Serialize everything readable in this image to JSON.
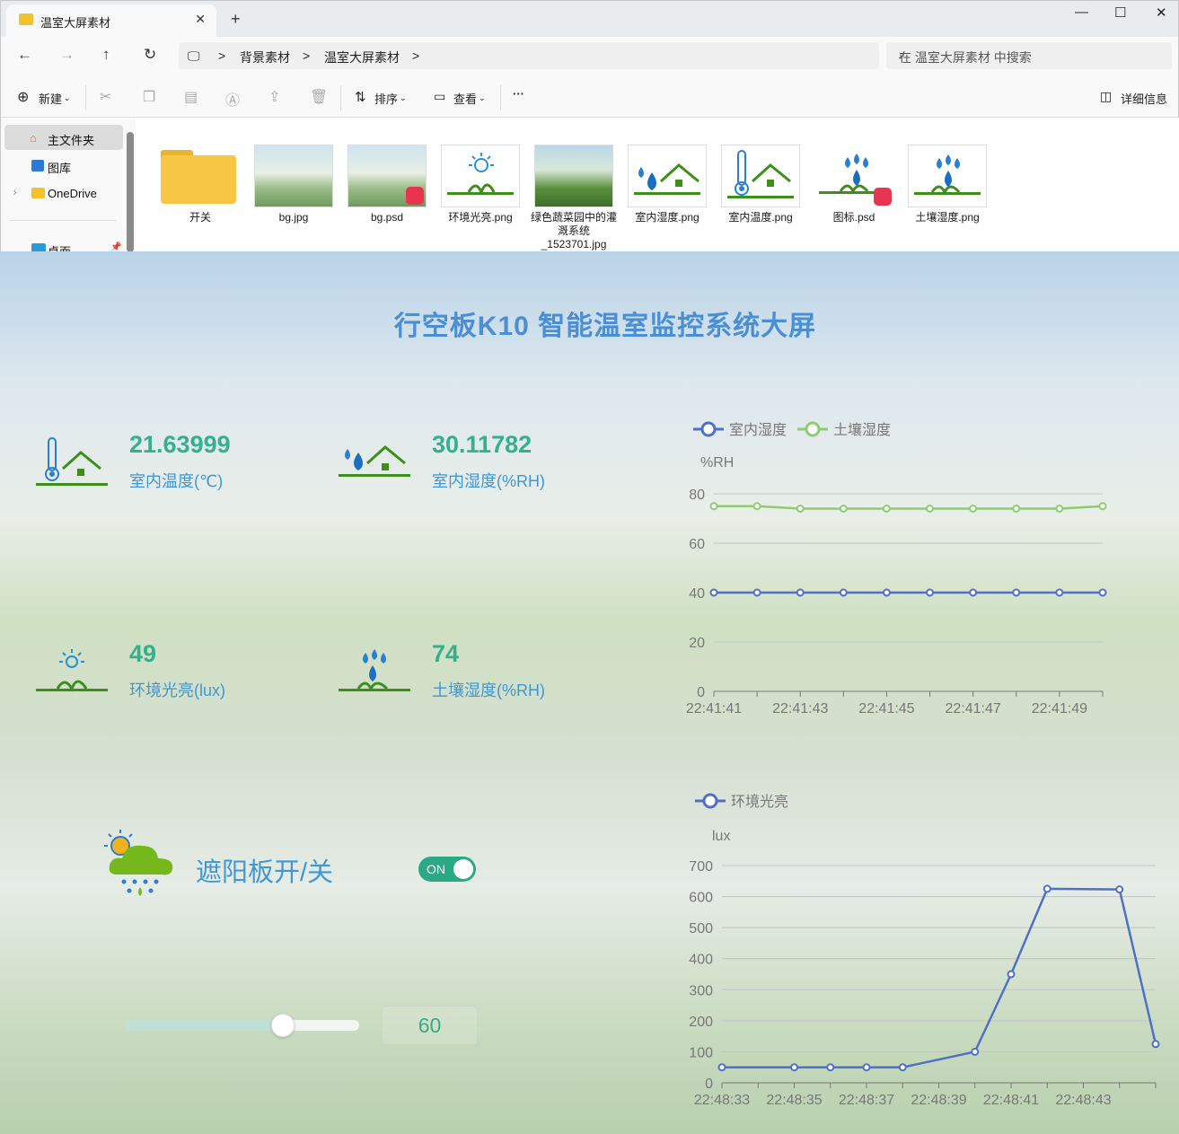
{
  "window": {
    "tab_title": "温室大屏素材",
    "close": "✕",
    "new_tab": "+",
    "controls": {
      "minimize": "—",
      "maximize": "☐",
      "close": "✕"
    }
  },
  "address": {
    "back": "←",
    "forward": "→",
    "up": "↑",
    "refresh": "↻",
    "crumbs": [
      "背景素材",
      "温室大屏素材"
    ],
    "separator": ">",
    "search_placeholder": "在 温室大屏素材 中搜索"
  },
  "commands": {
    "new": "新建",
    "sort": "排序",
    "view": "查看",
    "more": "···",
    "details": "详细信息"
  },
  "sidebar": {
    "items": [
      {
        "label": "主文件夹"
      },
      {
        "label": "图库"
      },
      {
        "label": "OneDrive"
      },
      {
        "label": "桌面"
      }
    ]
  },
  "files": [
    {
      "name": "开关",
      "kind": "folder"
    },
    {
      "name": "bg.jpg",
      "kind": "photo"
    },
    {
      "name": "bg.psd",
      "kind": "psd-photo"
    },
    {
      "name": "环境光亮.png",
      "kind": "sun-icon"
    },
    {
      "name": "绿色蔬菜园中的灌溉系统_1523701.jpg",
      "kind": "photo2"
    },
    {
      "name": "室内湿度.png",
      "kind": "humidity-icon"
    },
    {
      "name": "室内温度.png",
      "kind": "thermo-icon"
    },
    {
      "name": "图标.psd",
      "kind": "psd-icon"
    },
    {
      "name": "土壤湿度.png",
      "kind": "soil-icon"
    }
  ],
  "dashboard": {
    "title": "行空板K10 智能温室监控系统大屏",
    "cards": [
      {
        "value": "21.63999",
        "label": "室内温度(℃)",
        "icon": "thermometer-house-icon"
      },
      {
        "value": "30.11782",
        "label": "室内湿度(%RH)",
        "icon": "water-drop-house-icon"
      },
      {
        "value": "49",
        "label": "环境光亮(lux)",
        "icon": "sun-grass-icon"
      },
      {
        "value": "74",
        "label": "土壤湿度(%RH)",
        "icon": "drops-grass-icon"
      }
    ],
    "shade": {
      "label": "遮阳板开/关",
      "toggle_text": "ON",
      "toggle_on": true,
      "icon": "sun-rain-cloud-icon"
    },
    "slider": {
      "value": 60,
      "min": 0,
      "max": 100,
      "display": "60"
    },
    "colors": {
      "accent_green": "#34b08c",
      "accent_blue": "#3f97d6",
      "series_blue": "#5070c8",
      "series_green": "#8fcc70"
    }
  },
  "chart_data": [
    {
      "type": "line",
      "ylabel": "%RH",
      "ylim": [
        0,
        80
      ],
      "yticks": [
        0,
        20,
        40,
        60,
        80
      ],
      "x": [
        "22:41:41",
        "22:41:42",
        "22:41:43",
        "22:41:44",
        "22:41:45",
        "22:41:46",
        "22:41:47",
        "22:41:48",
        "22:41:49",
        "22:41:50"
      ],
      "xtick_labels": [
        "22:41:41",
        "22:41:43",
        "22:41:45",
        "22:41:47",
        "22:41:49"
      ],
      "grid": true,
      "legend": "top-left",
      "series": [
        {
          "name": "室内湿度",
          "color": "#5070c8",
          "values": [
            40,
            40,
            40,
            40,
            40,
            40,
            40,
            40,
            40,
            40
          ]
        },
        {
          "name": "土壤湿度",
          "color": "#8fcc70",
          "values": [
            75,
            75,
            74,
            74,
            74,
            74,
            74,
            74,
            74,
            75
          ]
        }
      ]
    },
    {
      "type": "line",
      "ylabel": "lux",
      "ylim": [
        0,
        700
      ],
      "yticks": [
        0,
        100,
        200,
        300,
        400,
        500,
        600,
        700
      ],
      "x": [
        "22:48:33",
        "22:48:34",
        "22:48:35",
        "22:48:36",
        "22:48:37",
        "22:48:38",
        "22:48:39",
        "22:48:40",
        "22:48:41",
        "22:48:42",
        "22:48:43",
        "22:48:44",
        "22:48:45"
      ],
      "xtick_labels": [
        "22:48:33",
        "22:48:35",
        "22:48:37",
        "22:48:39",
        "22:48:41",
        "22:48:43"
      ],
      "grid": true,
      "legend": "top-left",
      "series": [
        {
          "name": "环境光亮",
          "color": "#5070c8",
          "values": [
            50,
            null,
            50,
            50,
            50,
            50,
            null,
            100,
            350,
            625,
            null,
            623,
            125
          ]
        }
      ]
    }
  ]
}
